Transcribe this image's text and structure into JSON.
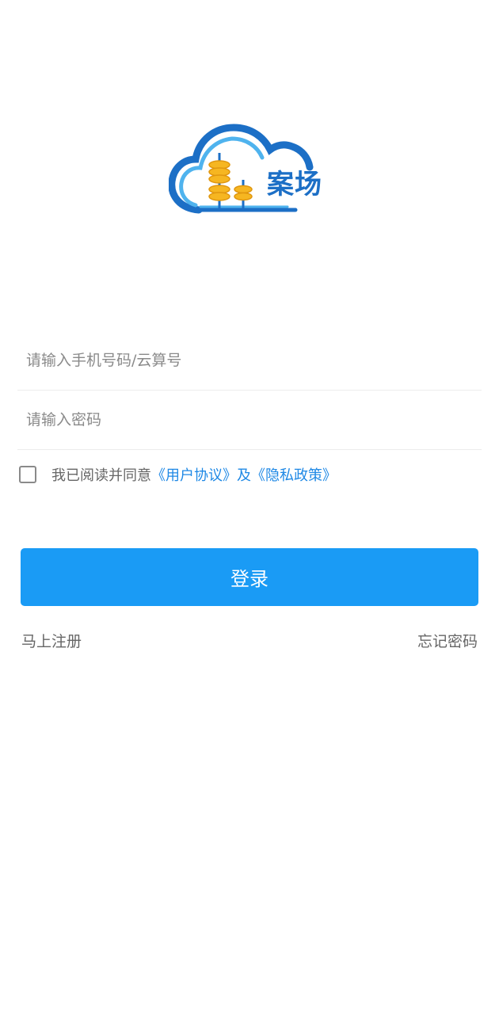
{
  "logo": {
    "text": "案场",
    "colors": {
      "cloud_outer": "#1c6fc6",
      "cloud_inner": "#4fb3ee",
      "coin": "#f6b621",
      "coin_edge": "#e09710"
    }
  },
  "form": {
    "phone_placeholder": "请输入手机号码/云算号",
    "phone_value": "",
    "password_placeholder": "请输入密码",
    "password_value": ""
  },
  "agreement": {
    "checked": false,
    "prefix": "我已阅读并同意",
    "user_agreement": "《用户协议》",
    "conjunction": "及",
    "privacy_policy": "《隐私政策》"
  },
  "login_button_label": "登录",
  "links": {
    "register": "马上注册",
    "forgot_password": "忘记密码"
  },
  "colors": {
    "accent": "#1a9bf5",
    "link": "#1e88e5",
    "background": "#ffffff"
  }
}
